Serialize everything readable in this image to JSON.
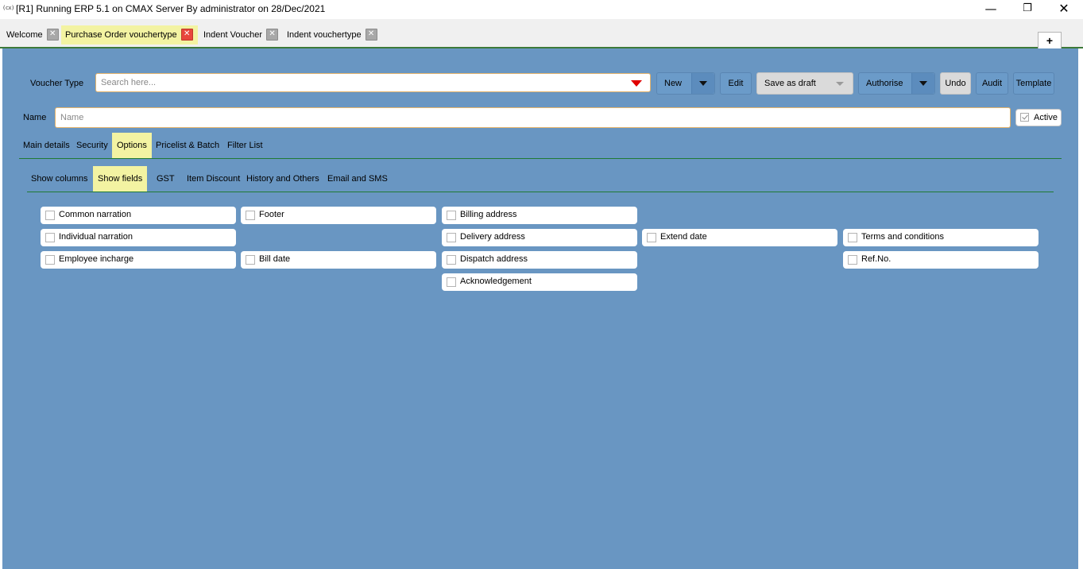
{
  "titlebar": {
    "icon_text": "(cx)",
    "title": "[R1] Running ERP 5.1 on CMAX Server By administrator on 28/Dec/2021",
    "minimize_glyph": "—",
    "restore_glyph": "❐",
    "close_glyph": "✕"
  },
  "tabs": [
    {
      "label": "Welcome",
      "active": false
    },
    {
      "label": "Purchase Order vouchertype",
      "active": true
    },
    {
      "label": "Indent Voucher",
      "active": false
    },
    {
      "label": "Indent vouchertype",
      "active": false
    }
  ],
  "tab_close_glyph": "✕",
  "add_tab_glyph": "+",
  "form": {
    "voucher_type_label": "Voucher Type",
    "search_placeholder": "Search here...",
    "name_label": "Name",
    "name_placeholder": "Name",
    "active_label": "Active"
  },
  "toolbar": {
    "new_label": "New",
    "edit_label": "Edit",
    "save_draft_label": "Save as draft",
    "authorise_label": "Authorise",
    "undo_label": "Undo",
    "audit_label": "Audit",
    "template_label": "Template"
  },
  "main_tabs": [
    "Main details",
    "Security",
    "Options",
    "Pricelist & Batch",
    "Filter List"
  ],
  "main_tab_active": "Options",
  "sub_tabs": [
    "Show columns",
    "Show fields",
    "GST",
    "Item Discount",
    "History and Others",
    "Email and SMS"
  ],
  "sub_tab_active": "Show fields",
  "fields": {
    "common_narration": "Common narration",
    "individual_narration": "Individual narration",
    "employee_incharge": "Employee incharge",
    "footer": "Footer",
    "bill_date": "Bill date",
    "billing_address": "Billing address",
    "delivery_address": "Delivery address",
    "dispatch_address": "Dispatch address",
    "acknowledgement": "Acknowledgement",
    "extend_date": "Extend date",
    "terms_and_conditions": "Terms and conditions",
    "ref_no": "Ref.No."
  },
  "colors": {
    "panel_bg": "#6996c2",
    "active_tab_bg": "#f3f3a2",
    "accent_green": "#1f7a34",
    "dropdown_arrow": "#e00000"
  },
  "icons": {
    "dropdown": "red-triangle-down",
    "split": "black-triangle-down",
    "checkbox": "empty-checkbox",
    "active_check": "check-mark"
  }
}
